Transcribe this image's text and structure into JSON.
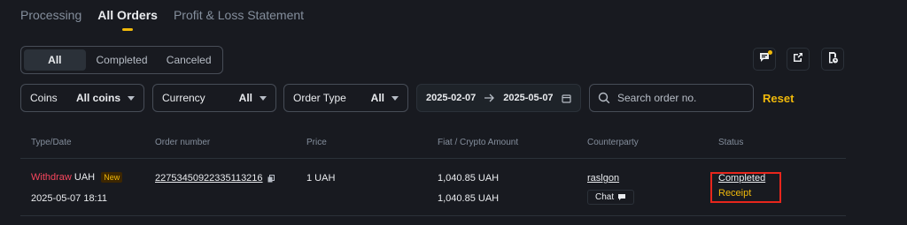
{
  "tabs": [
    "Processing",
    "All Orders",
    "Profit & Loss Statement"
  ],
  "segment": [
    "All",
    "Completed",
    "Canceled"
  ],
  "toolbar_icons": [
    "chat-notification-icon",
    "export-icon",
    "history-icon"
  ],
  "filters": {
    "coins": {
      "label": "Coins",
      "value": "All coins"
    },
    "currency": {
      "label": "Currency",
      "value": "All"
    },
    "order_type": {
      "label": "Order Type",
      "value": "All"
    }
  },
  "date_range": {
    "start": "2025-02-07",
    "end": "2025-05-07"
  },
  "search": {
    "placeholder": "Search order no."
  },
  "reset_label": "Reset",
  "table": {
    "headers": [
      "Type/Date",
      "Order number",
      "Price",
      "Fiat / Crypto Amount",
      "Counterparty",
      "Status"
    ],
    "row": {
      "type": "Withdraw",
      "currency": "UAH",
      "badge": "New",
      "date": "2025-05-07 18:11",
      "order_number": "22753450922335113216",
      "price": "1 UAH",
      "fiat_amount": "1,040.85 UAH",
      "crypto_amount": "1,040.85 UAH",
      "counterparty": "raslgon",
      "chat_label": "Chat",
      "status": "Completed",
      "receipt": "Receipt"
    }
  },
  "colors": {
    "background": "#181a20",
    "accent": "#f0b90b",
    "sell": "#f6465d",
    "highlight": "#e8261c"
  }
}
